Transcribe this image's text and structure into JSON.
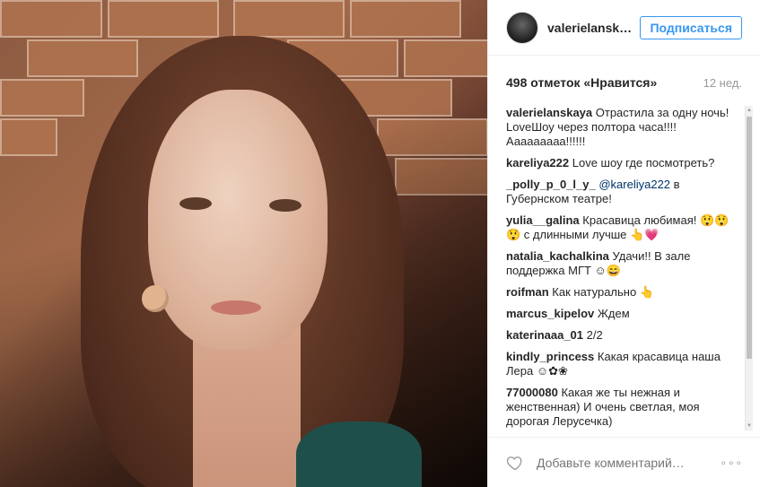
{
  "header": {
    "username": "valerielansk…",
    "follow_label": "Подписаться"
  },
  "stats": {
    "likes": "498 отметок «Нравится»",
    "time": "12 нед."
  },
  "comments": [
    {
      "user": "valerielanskaya",
      "text": "Отрастила за одну ночь!\nLoveШоу через полтора часа!!!! Ааааааааа!!!!!!"
    },
    {
      "user": "kareliya222",
      "text": "Love шоу где посмотреть?"
    },
    {
      "user": "_polly_p_0_l_y_",
      "mention": "@kareliya222",
      "text": " в Губернском театре!"
    },
    {
      "user": "yulia__galina",
      "text": "Красавица любимая! 😲😲😲 с длинными лучше 👆💗"
    },
    {
      "user": "natalia_kachalkina",
      "text": "Удачи!! В зале поддержка МГТ ☺😄"
    },
    {
      "user": "roifman",
      "text": "Как натурально 👆"
    },
    {
      "user": "marcus_kipelov",
      "text": "Ждем"
    },
    {
      "user": "katerinaaa_01",
      "text": "2/2"
    },
    {
      "user": "kindly_princess",
      "text": "Какая красавица наша Лера ☺✿❀"
    },
    {
      "user": "77000080",
      "text": "Какая же ты нежная и женственная) И очень светлая, моя дорогая Лерусечка)"
    }
  ],
  "footer": {
    "add_comment_placeholder": "Добавьте комментарий…",
    "more": "∘∘∘"
  },
  "icons": {
    "heart": "heart-icon",
    "more": "more-options-icon"
  },
  "colors": {
    "accent": "#3897f0",
    "mention": "#003569",
    "muted": "#999999"
  }
}
